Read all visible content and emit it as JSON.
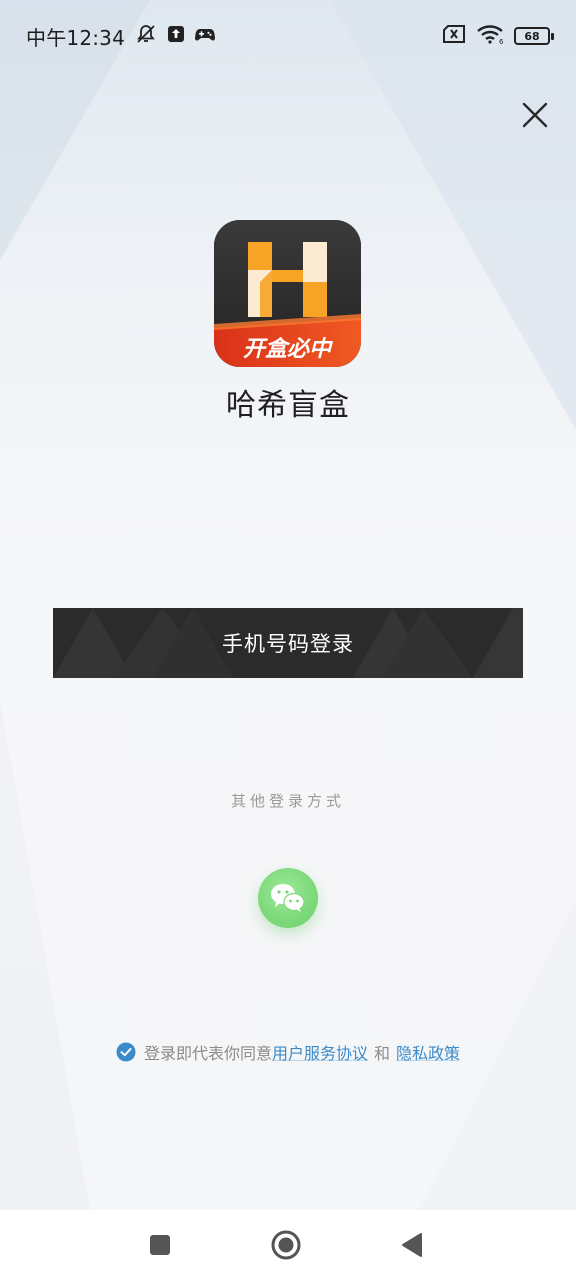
{
  "status_bar": {
    "time": "中午12:34",
    "battery": "68",
    "icons": [
      "mute-bell-icon",
      "upload-icon",
      "gamepad-icon",
      "sim-error-icon",
      "wifi-icon",
      "battery-icon"
    ]
  },
  "close_icon": "close-icon",
  "app": {
    "name": "哈希盲盒",
    "icon_letter": "H",
    "icon_slogan": "开盒必中",
    "colors": {
      "orange": "#F7A325",
      "cream": "#FBEBD0",
      "red": "#E8421E",
      "dark": "#2B2B2B"
    }
  },
  "login": {
    "phone_button": "手机号码登录",
    "other_methods": "其他登录方式",
    "wechat_icon": "wechat-icon",
    "wechat_color": "#7CD97A"
  },
  "agreement": {
    "checked": true,
    "prefix": "登录即代表你同意",
    "user_agreement": "用户服务协议",
    "and": "和",
    "privacy_policy": "隐私政策",
    "link_color": "#3C8AC8"
  },
  "nav_bar": {
    "icons": [
      "recents-square-icon",
      "home-circle-icon",
      "back-triangle-icon"
    ]
  }
}
